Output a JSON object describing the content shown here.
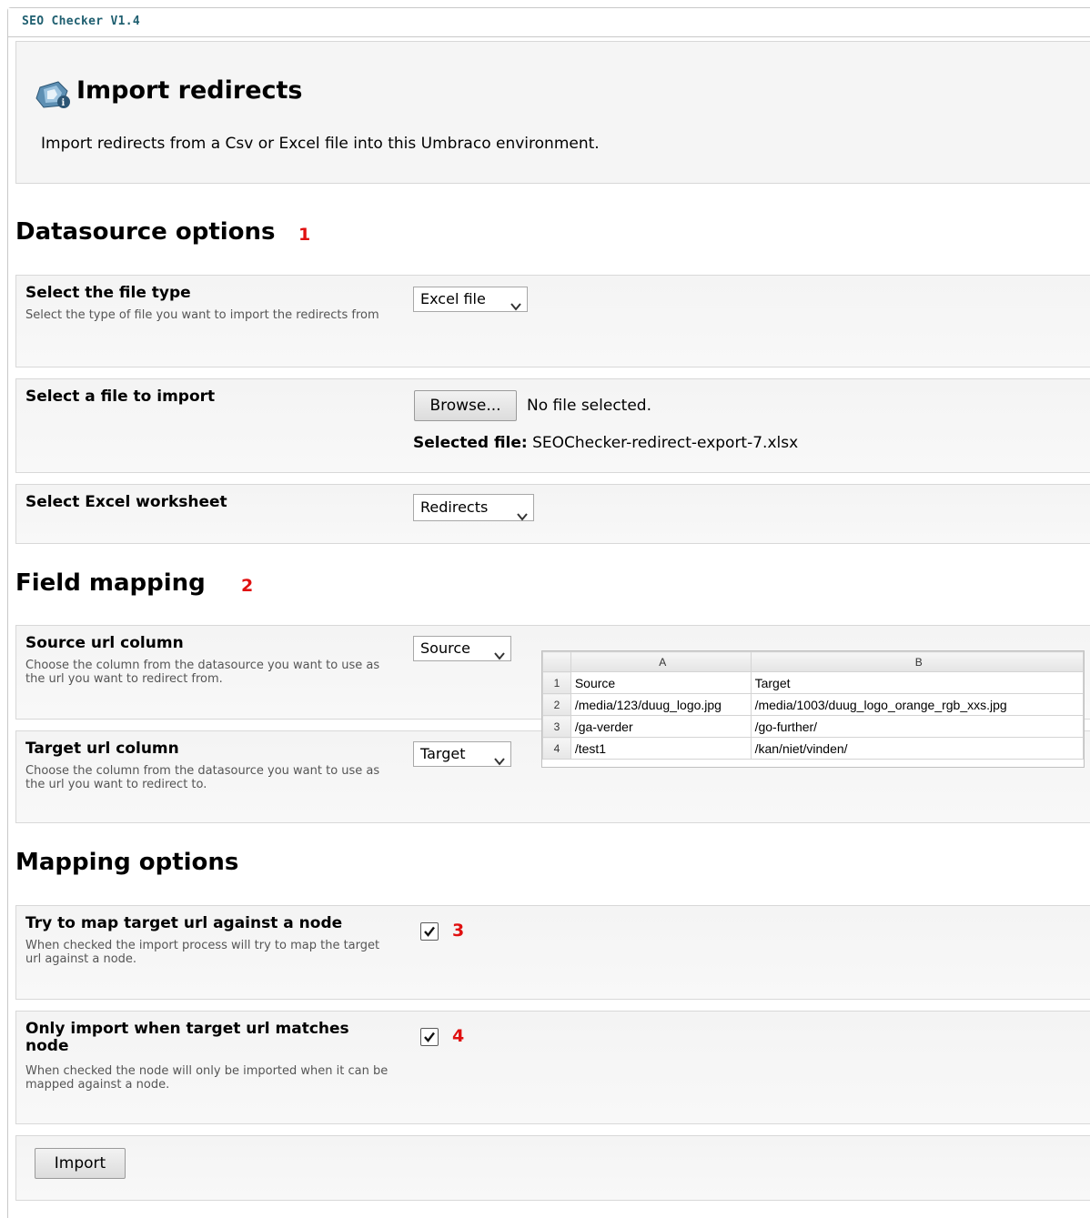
{
  "app": {
    "title": "SEO Checker V1.4"
  },
  "header": {
    "title": "Import redirects",
    "description": "Import redirects from a Csv or Excel file into this Umbraco environment."
  },
  "datasource": {
    "heading": "Datasource options",
    "marker": "1",
    "file_type": {
      "label": "Select the file type",
      "description": "Select the type of file you want to import the redirects from",
      "value": "Excel file"
    },
    "file": {
      "label": "Select a file to import",
      "browse_label": "Browse...",
      "no_file_text": "No file selected.",
      "selected_prefix": "Selected file:",
      "selected_name": "SEOChecker-redirect-export-7.xlsx"
    },
    "worksheet": {
      "label": "Select Excel worksheet",
      "value": "Redirects"
    }
  },
  "field_mapping": {
    "heading": "Field mapping",
    "marker": "2",
    "source": {
      "label": "Source url column",
      "description": "Choose the column from the datasource you want to use as the url you want to redirect from.",
      "value": "Source"
    },
    "target": {
      "label": "Target url column",
      "description": "Choose the column from the datasource you want to use as the url you want to redirect to.",
      "value": "Target"
    },
    "preview": {
      "columns": [
        "A",
        "B"
      ],
      "rows": [
        {
          "n": "1",
          "a": "Source",
          "b": "Target"
        },
        {
          "n": "2",
          "a": "/media/123/duug_logo.jpg",
          "b": "/media/1003/duug_logo_orange_rgb_xxs.jpg"
        },
        {
          "n": "3",
          "a": "/ga-verder",
          "b": "/go-further/"
        },
        {
          "n": "4",
          "a": "/test1",
          "b": "/kan/niet/vinden/"
        }
      ]
    }
  },
  "mapping_options": {
    "heading": "Mapping options",
    "try_map": {
      "label": "Try to map target url against a node",
      "description": "When checked the import process will try to map the target url against a node.",
      "checked": true,
      "marker": "3"
    },
    "only_import": {
      "label": "Only import when target url matches node",
      "description": "When checked the node will only be imported when it can be mapped against a node.",
      "checked": true,
      "marker": "4"
    }
  },
  "actions": {
    "import_label": "Import"
  },
  "colors": {
    "accent_title": "#1f5f70",
    "marker_red": "#e01010",
    "panel_bg": "#f4f4f4"
  },
  "icons": {
    "header": "import-redirects-icon",
    "chevron": "chevron-down-icon",
    "check": "checkmark-icon"
  }
}
